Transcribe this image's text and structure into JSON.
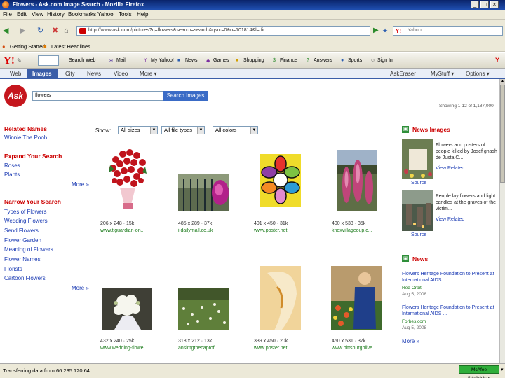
{
  "window": {
    "title": "Flowers - Ask.com Image Search - Mozilla Firefox"
  },
  "menubar": {
    "items": [
      "File",
      "Edit",
      "View",
      "History",
      "Bookmarks",
      "Yahoo!",
      "Tools",
      "Help"
    ]
  },
  "navbar": {
    "url": "http://www.ask.com/pictures?q=flowers&search=search&qsrc=0&o=101814&l=dir",
    "search_placeholder": "Yahoo"
  },
  "bookmarks": {
    "items": [
      "Getting Started",
      "Latest Headlines"
    ]
  },
  "yahoo_toolbar": {
    "logo": "Y!",
    "items": [
      "Search Web",
      "Mail",
      "My Yahoo!",
      "News",
      "Games",
      "Shopping",
      "Finance",
      "Answers",
      "Sports",
      "Sign In"
    ]
  },
  "ask_tabs": {
    "items": [
      "Web",
      "Images",
      "City",
      "News",
      "Video",
      "More ▾"
    ],
    "right_items": [
      "AskEraser",
      "MyStuff ▾",
      "Options ▾"
    ]
  },
  "ask_search": {
    "logo": "Ask",
    "query": "flowers",
    "button": "Search Images",
    "showing": "Showing 1-12 of 1,187,000"
  },
  "left": {
    "related_head": "Related Names",
    "related_links": [
      "Winnie The Pooh"
    ],
    "expand_head": "Expand Your Search",
    "expand_links": [
      "Roses",
      "Plants"
    ],
    "narrow_head": "Narrow Your Search",
    "narrow_links": [
      "Types of Flowers",
      "Wedding Flowers",
      "Send Flowers",
      "Flower Garden",
      "Meaning of Flowers",
      "Flower Names",
      "Florists",
      "Cartoon Flowers"
    ],
    "more": "More »"
  },
  "filters": {
    "show_label": "Show:",
    "size": "All sizes",
    "filetype": "All file types",
    "color": "All colors"
  },
  "results": [
    {
      "meta": "206 x 248 · 15k",
      "site": "www.tiguardian-on..."
    },
    {
      "meta": "485 x 289 · 37k",
      "site": "i.dailymail.co.uk"
    },
    {
      "meta": "401 x 450 · 31k",
      "site": "www.poster.net"
    },
    {
      "meta": "400 x 533 · 35k",
      "site": "knoxvillageoup.c..."
    },
    {
      "meta": "432 x 240 · 25k",
      "site": "www.wedding-flowe..."
    },
    {
      "meta": "318 x 212 · 13k",
      "site": "ansimgthecaprof..."
    },
    {
      "meta": "339 x 450 · 20k",
      "site": "www.poster.net"
    },
    {
      "meta": "450 x 531 · 37k",
      "site": "www.pittsburghlive..."
    }
  ],
  "right": {
    "news_images_head": "News Images",
    "news_images": [
      {
        "text": "Flowers and posters of people killed by Josef gnash de Justa C...",
        "link": "View Related",
        "source": "Source"
      },
      {
        "text": "People lay flowers and light candles at the graves of the victim...",
        "link": "View Related",
        "source": "Source"
      }
    ],
    "news_head": "News",
    "news": [
      {
        "text": "Flowers Heritage Foundation to Present at International AIDS ...",
        "source": "Red Orbit",
        "date": "Aug 5, 2008"
      },
      {
        "text": "Flowers Heritage Foundation to Present at International AIDS ...",
        "source": "Forbes.com",
        "date": "Aug 5, 2008"
      }
    ],
    "more": "More »"
  },
  "statusbar": {
    "text": "Transferring data from 66.235.120.64...",
    "mcafee": "McAfee SiteAdvisor"
  }
}
